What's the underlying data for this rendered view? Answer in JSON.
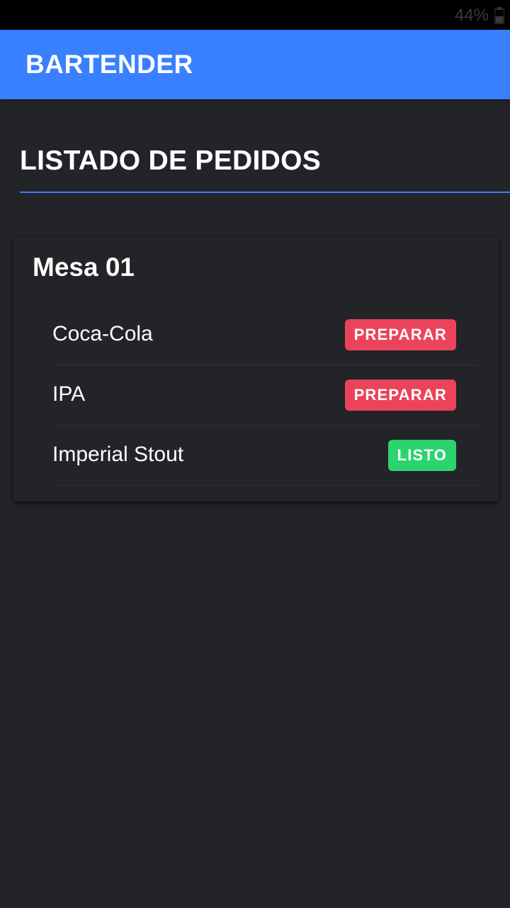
{
  "status_bar": {
    "battery_text": "44%",
    "battery_icon": "battery-icon"
  },
  "app_bar": {
    "title": "BARTENDER"
  },
  "page": {
    "section_title": "LISTADO DE PEDIDOS"
  },
  "colors": {
    "primary": "#3880ff",
    "background": "#222428",
    "danger": "#eb445a",
    "success": "#2dd36f"
  },
  "orders": {
    "table_title": "Mesa 01",
    "items": [
      {
        "name": "Coca-Cola",
        "action_label": "PREPARAR",
        "status": "danger"
      },
      {
        "name": "IPA",
        "action_label": "PREPARAR",
        "status": "danger"
      },
      {
        "name": "Imperial Stout",
        "action_label": "LISTO",
        "status": "success"
      }
    ]
  }
}
